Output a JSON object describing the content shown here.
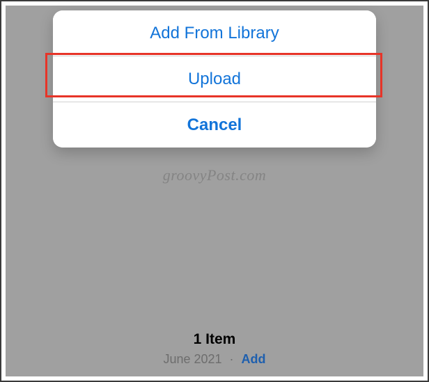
{
  "actionSheet": {
    "addFromLibrary": "Add From Library",
    "upload": "Upload",
    "cancel": "Cancel"
  },
  "watermark": "groovyPost.com",
  "footer": {
    "itemCount": "1 Item",
    "date": "June 2021",
    "addLabel": "Add"
  }
}
